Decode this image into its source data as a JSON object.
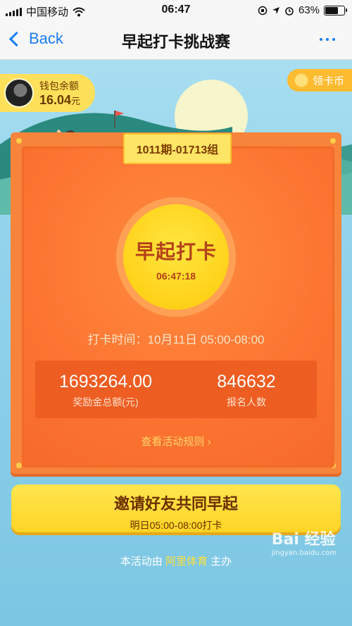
{
  "status_bar": {
    "carrier": "中国移动",
    "time": "06:47",
    "battery": "63%"
  },
  "nav": {
    "back_label": "Back",
    "title": "早起打卡挑战赛"
  },
  "wallet": {
    "label": "钱包余额",
    "amount": "16.04",
    "unit": "元"
  },
  "coin_button": {
    "label": "领卡币"
  },
  "group_tag": "1011期-01713组",
  "checkin": {
    "title": "早起打卡",
    "clock": "06:47:18",
    "time_text": "打卡时间：10月11日 05:00-08:00"
  },
  "stats": [
    {
      "value": "1693264.00",
      "label": "奖励金总额(元)"
    },
    {
      "value": "846632",
      "label": "报名人数"
    }
  ],
  "rules_link": "查看活动规则 ›",
  "invite": {
    "title": "邀请好友共同早起",
    "subtitle": "明日05:00-08:00打卡"
  },
  "footer": {
    "prefix": "本活动由",
    "brand": "阿里体育",
    "suffix": "主办"
  },
  "watermark": {
    "text": "Bai 经验",
    "url": "jingyan.baidu.com"
  }
}
